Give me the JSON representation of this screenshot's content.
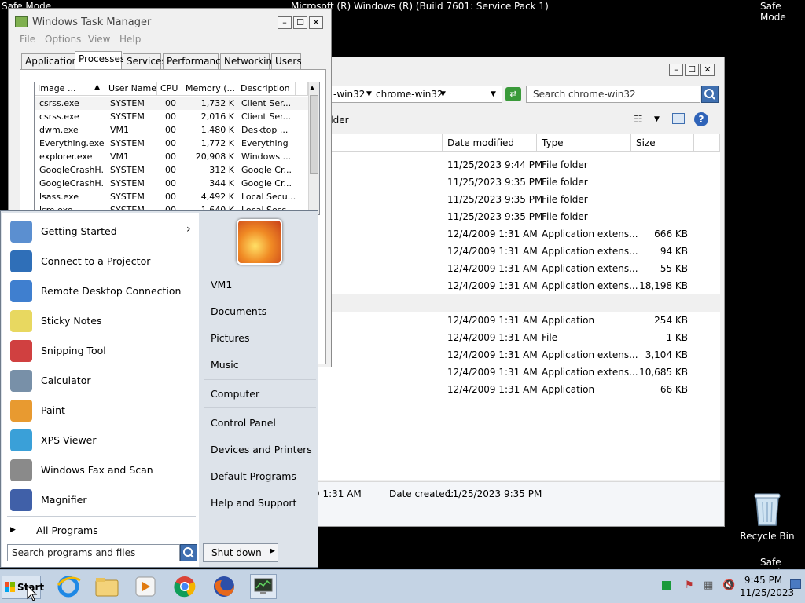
{
  "desktop": {
    "safe_mode": "Safe Mode",
    "build": "Microsoft (R) Windows (R) (Build 7601: Service Pack 1)",
    "recycle_bin": "Recycle Bin"
  },
  "explorer": {
    "breadcrumb_part1": "-win32",
    "breadcrumb_part2": "chrome-win32",
    "search_placeholder": "Search chrome-win32",
    "new_folder": "older",
    "columns": [
      "Date modified",
      "Type",
      "Size"
    ],
    "rows": [
      {
        "date": "11/25/2023 9:44 PM",
        "type": "File folder",
        "size": ""
      },
      {
        "date": "11/25/2023 9:35 PM",
        "type": "File folder",
        "size": ""
      },
      {
        "date": "11/25/2023 9:35 PM",
        "type": "File folder",
        "size": ""
      },
      {
        "date": "11/25/2023 9:35 PM",
        "type": "File folder",
        "size": ""
      },
      {
        "date": "12/4/2009 1:31 AM",
        "type": "Application extens...",
        "size": "666 KB"
      },
      {
        "date": "12/4/2009 1:31 AM",
        "type": "Application extens...",
        "size": "94 KB"
      },
      {
        "date": "12/4/2009 1:31 AM",
        "type": "Application extens...",
        "size": "55 KB"
      },
      {
        "date": "12/4/2009 1:31 AM",
        "type": "Application extens...",
        "size": "18,198 KB"
      },
      {
        "date": "",
        "type": "",
        "size": ""
      },
      {
        "date": "12/4/2009 1:31 AM",
        "type": "Application",
        "size": "254 KB"
      },
      {
        "date": "12/4/2009 1:31 AM",
        "type": "File",
        "size": "1 KB"
      },
      {
        "date": "12/4/2009 1:31 AM",
        "type": "Application extens...",
        "size": "3,104 KB"
      },
      {
        "date": "12/4/2009 1:31 AM",
        "type": "Application extens...",
        "size": "10,685 KB"
      },
      {
        "date": "12/4/2009 1:31 AM",
        "type": "Application",
        "size": "66 KB"
      }
    ],
    "details_modified_tail": "9 1:31 AM",
    "details_created_label": "Date created:",
    "details_created_value": "11/25/2023 9:35 PM"
  },
  "taskman": {
    "title": "Windows Task Manager",
    "menu": [
      "File",
      "Options",
      "View",
      "Help"
    ],
    "tabs": [
      "Applications",
      "Processes",
      "Services",
      "Performance",
      "Networking",
      "Users"
    ],
    "columns": [
      "Image ...",
      "User Name",
      "CPU",
      "Memory (...",
      "Description"
    ],
    "processes": [
      {
        "image": "csrss.exe",
        "user": "SYSTEM",
        "cpu": "00",
        "mem": "1,732 K",
        "desc": "Client Ser..."
      },
      {
        "image": "csrss.exe",
        "user": "SYSTEM",
        "cpu": "00",
        "mem": "2,016 K",
        "desc": "Client Ser..."
      },
      {
        "image": "dwm.exe",
        "user": "VM1",
        "cpu": "00",
        "mem": "1,480 K",
        "desc": "Desktop ..."
      },
      {
        "image": "Everything.exe",
        "user": "SYSTEM",
        "cpu": "00",
        "mem": "1,772 K",
        "desc": "Everything"
      },
      {
        "image": "explorer.exe",
        "user": "VM1",
        "cpu": "00",
        "mem": "20,908 K",
        "desc": "Windows ..."
      },
      {
        "image": "GoogleCrashH...",
        "user": "SYSTEM",
        "cpu": "00",
        "mem": "312 K",
        "desc": "Google Cr..."
      },
      {
        "image": "GoogleCrashH...",
        "user": "SYSTEM",
        "cpu": "00",
        "mem": "344 K",
        "desc": "Google Cr..."
      },
      {
        "image": "lsass.exe",
        "user": "SYSTEM",
        "cpu": "00",
        "mem": "4,492 K",
        "desc": "Local Secu..."
      },
      {
        "image": "lsm.exe",
        "user": "SYSTEM",
        "cpu": "00",
        "mem": "1,640 K",
        "desc": "Local Sess..."
      }
    ]
  },
  "startmenu": {
    "programs": [
      {
        "label": "Getting Started",
        "color": "#5b8fd0",
        "arrow": "›"
      },
      {
        "label": "Connect to a Projector",
        "color": "#2f6fb8",
        "arrow": ""
      },
      {
        "label": "Remote Desktop Connection",
        "color": "#3f7fcf",
        "arrow": ""
      },
      {
        "label": "Sticky Notes",
        "color": "#e8d860",
        "arrow": ""
      },
      {
        "label": "Snipping Tool",
        "color": "#d04040",
        "arrow": ""
      },
      {
        "label": "Calculator",
        "color": "#7890a8",
        "arrow": ""
      },
      {
        "label": "Paint",
        "color": "#e89a30",
        "arrow": ""
      },
      {
        "label": "XPS Viewer",
        "color": "#3aa0d8",
        "arrow": ""
      },
      {
        "label": "Windows Fax and Scan",
        "color": "#8a8a8a",
        "arrow": ""
      },
      {
        "label": "Magnifier",
        "color": "#4060a8",
        "arrow": ""
      }
    ],
    "all_programs": "All Programs",
    "search_placeholder": "Search programs and files",
    "shutdown": "Shut down",
    "user": "VM1",
    "right_items": [
      "Documents",
      "Pictures",
      "Music",
      "Computer",
      "Control Panel",
      "Devices and Printers",
      "Default Programs",
      "Help and Support"
    ]
  },
  "taskbar": {
    "start": "Start",
    "time": "9:45 PM",
    "date": "11/25/2023"
  }
}
